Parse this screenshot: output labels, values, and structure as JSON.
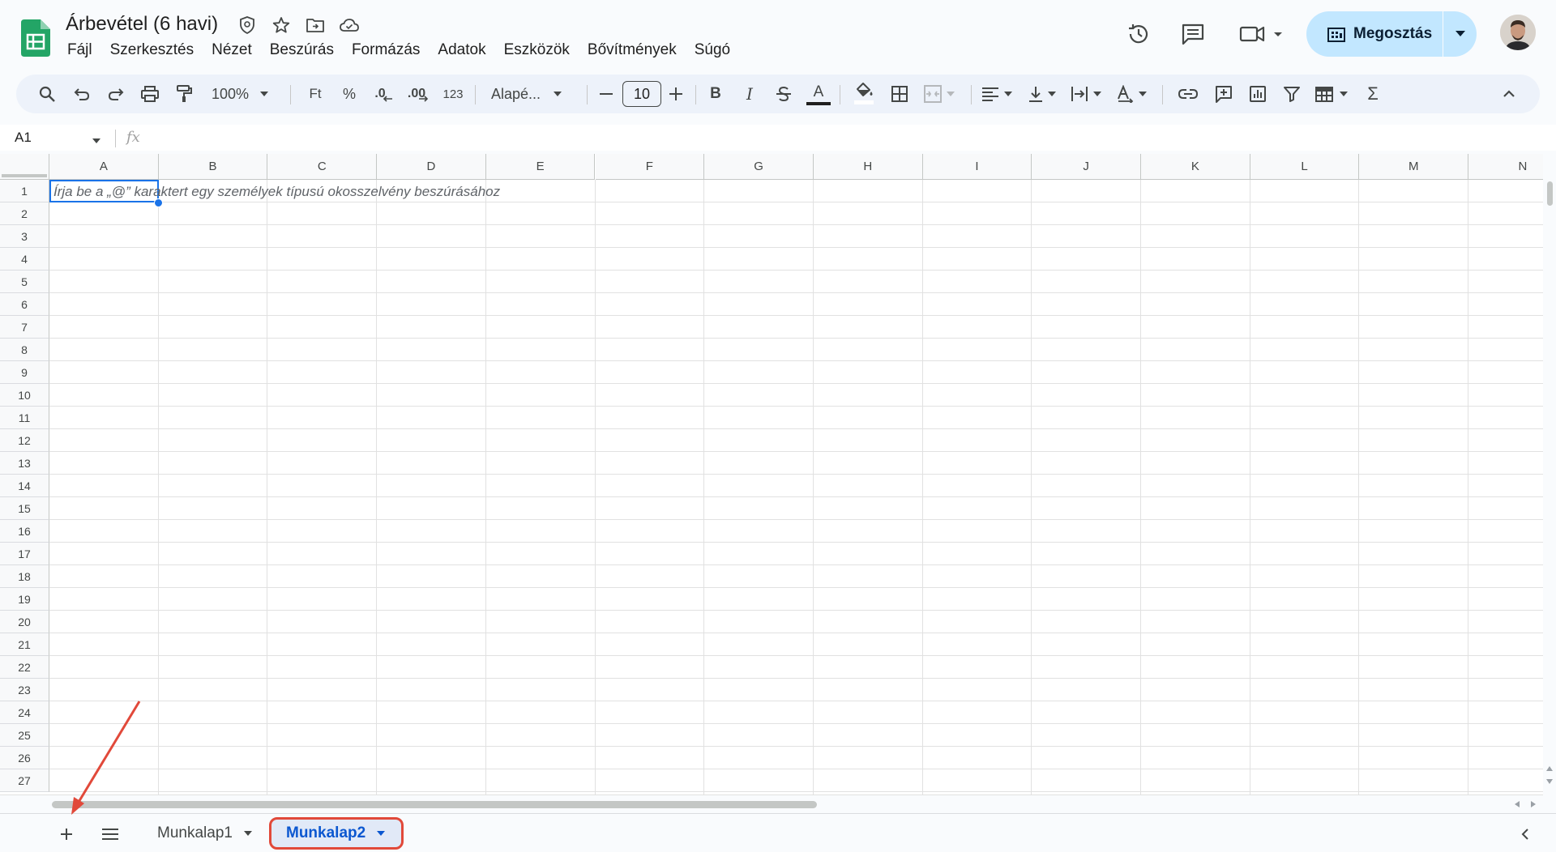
{
  "document": {
    "title": "Árbevétel (6 havi)"
  },
  "menu": [
    "Fájl",
    "Szerkesztés",
    "Nézet",
    "Beszúrás",
    "Formázás",
    "Adatok",
    "Eszközök",
    "Bővítmények",
    "Súgó"
  ],
  "share": {
    "label": "Megosztás"
  },
  "toolbar": {
    "zoom": "100%",
    "currency": "Ft",
    "percent": "%",
    "decrease_decimals": ".0",
    "increase_decimals": ".00",
    "more_formats": "123",
    "font": "Alapé...",
    "font_size": "10",
    "bold": "B",
    "italic": "I",
    "text_color_glyph": "A",
    "sum": "Σ"
  },
  "formula_bar": {
    "cell_ref": "A1",
    "fx": "fx"
  },
  "grid": {
    "columns": [
      "A",
      "B",
      "C",
      "D",
      "E",
      "F",
      "G",
      "H",
      "I",
      "J",
      "K",
      "L",
      "M",
      "N"
    ],
    "rows": [
      "1",
      "2",
      "3",
      "4",
      "5",
      "6",
      "7",
      "8",
      "9",
      "10",
      "11",
      "12",
      "13",
      "14",
      "15",
      "16",
      "17",
      "18",
      "19",
      "20",
      "21",
      "22",
      "23",
      "24",
      "25",
      "26",
      "27"
    ],
    "a1_placeholder": "Írja be a „@” karaktert egy személyek típusú okosszelvény beszúrásához"
  },
  "sheets": [
    {
      "name": "Munkalap1",
      "active": false
    },
    {
      "name": "Munkalap2",
      "active": true
    }
  ],
  "colors": {
    "accent": "#0b57d0",
    "share_bg": "#c2e7ff",
    "highlight": "#e1493a",
    "selection": "#1a73e8"
  }
}
